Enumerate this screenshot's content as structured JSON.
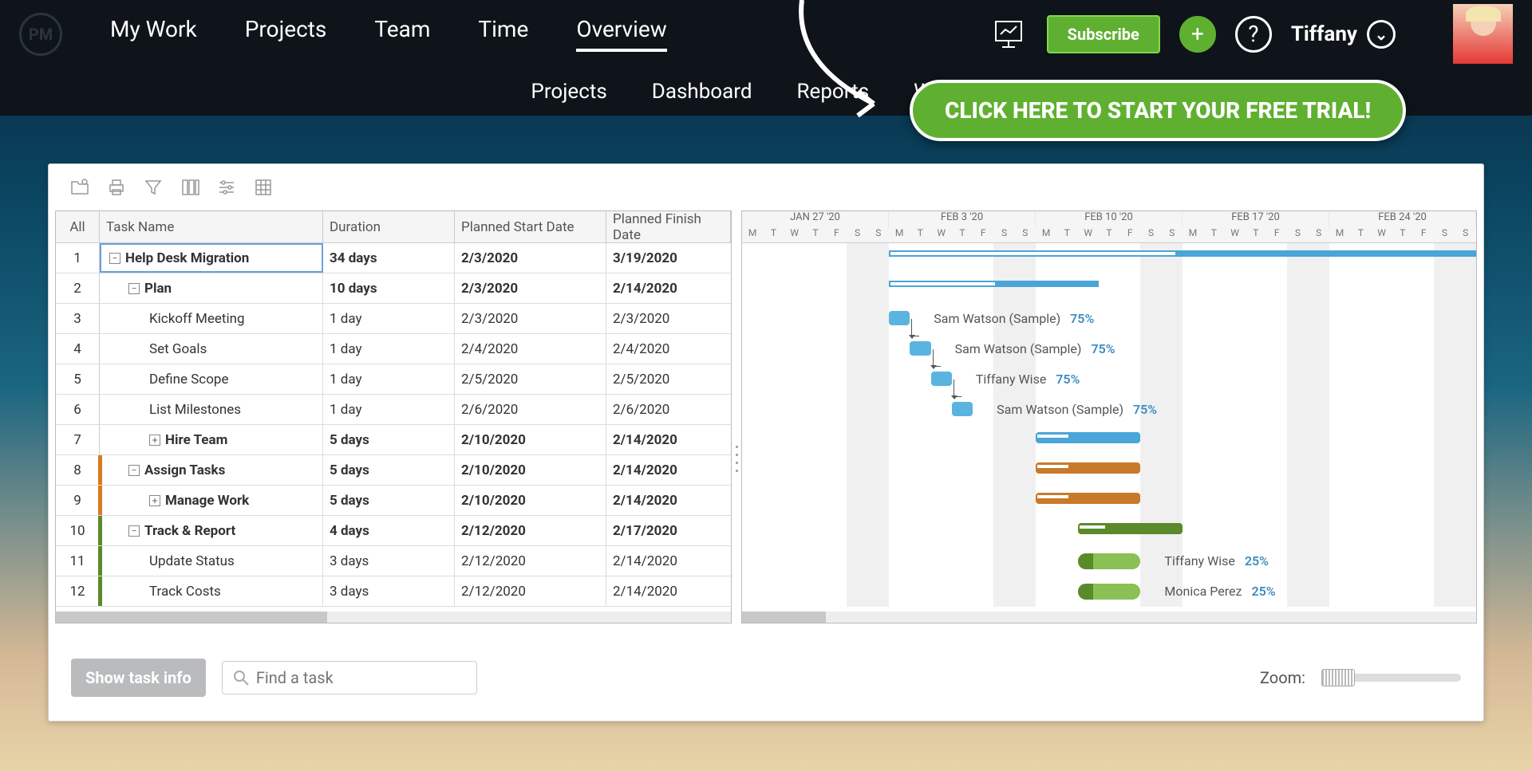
{
  "brand": "PM",
  "nav": {
    "main": [
      "My Work",
      "Projects",
      "Team",
      "Time",
      "Overview"
    ],
    "main_active": 4,
    "sub": [
      "Projects",
      "Dashboard",
      "Reports",
      "Workload"
    ]
  },
  "topright": {
    "subscribe": "Subscribe",
    "plus": "+",
    "help": "?",
    "user": "Tiffany"
  },
  "cta": "CLICK HERE TO START YOUR FREE TRIAL!",
  "columns": {
    "all": "All",
    "task": "Task Name",
    "duration": "Duration",
    "start": "Planned Start Date",
    "finish": "Planned Finish Date"
  },
  "tasks": [
    {
      "n": "1",
      "name": "Help Desk Migration",
      "dur": "34 days",
      "start": "2/3/2020",
      "finish": "3/19/2020",
      "indent": 0,
      "bold": true,
      "exp": "-",
      "sel": true
    },
    {
      "n": "2",
      "name": "Plan",
      "dur": "10 days",
      "start": "2/3/2020",
      "finish": "2/14/2020",
      "indent": 1,
      "bold": true,
      "exp": "-"
    },
    {
      "n": "3",
      "name": "Kickoff Meeting",
      "dur": "1 day",
      "start": "2/3/2020",
      "finish": "2/3/2020",
      "indent": 2
    },
    {
      "n": "4",
      "name": "Set Goals",
      "dur": "1 day",
      "start": "2/4/2020",
      "finish": "2/4/2020",
      "indent": 2
    },
    {
      "n": "5",
      "name": "Define Scope",
      "dur": "1 day",
      "start": "2/5/2020",
      "finish": "2/5/2020",
      "indent": 2
    },
    {
      "n": "6",
      "name": "List Milestones",
      "dur": "1 day",
      "start": "2/6/2020",
      "finish": "2/6/2020",
      "indent": 2
    },
    {
      "n": "7",
      "name": "Hire Team",
      "dur": "5 days",
      "start": "2/10/2020",
      "finish": "2/14/2020",
      "indent": 2,
      "bold": true,
      "exp": "+"
    },
    {
      "n": "8",
      "name": "Assign Tasks",
      "dur": "5 days",
      "start": "2/10/2020",
      "finish": "2/14/2020",
      "indent": 1,
      "bold": true,
      "exp": "-",
      "strip": "orange"
    },
    {
      "n": "9",
      "name": "Manage Work",
      "dur": "5 days",
      "start": "2/10/2020",
      "finish": "2/14/2020",
      "indent": 2,
      "bold": true,
      "exp": "+",
      "strip": "orange"
    },
    {
      "n": "10",
      "name": "Track & Report",
      "dur": "4 days",
      "start": "2/12/2020",
      "finish": "2/17/2020",
      "indent": 1,
      "bold": true,
      "exp": "-",
      "strip": "green"
    },
    {
      "n": "11",
      "name": "Update Status",
      "dur": "3 days",
      "start": "2/12/2020",
      "finish": "2/14/2020",
      "indent": 2,
      "strip": "green"
    },
    {
      "n": "12",
      "name": "Track Costs",
      "dur": "3 days",
      "start": "2/12/2020",
      "finish": "2/14/2020",
      "indent": 2,
      "strip": "green"
    }
  ],
  "weeks": [
    "JAN 27 '20",
    "FEB 3 '20",
    "FEB 10 '20",
    "FEB 17 '20",
    "FEB 24 '20"
  ],
  "days": [
    "M",
    "T",
    "W",
    "T",
    "F",
    "S",
    "S"
  ],
  "gantt_labels": [
    {
      "row": 2,
      "name": "Sam Watson (Sample)",
      "pct": "75%"
    },
    {
      "row": 3,
      "name": "Sam Watson (Sample)",
      "pct": "75%"
    },
    {
      "row": 4,
      "name": "Tiffany Wise",
      "pct": "75%"
    },
    {
      "row": 5,
      "name": "Sam Watson (Sample)",
      "pct": "75%"
    },
    {
      "row": 10,
      "name": "Tiffany Wise",
      "pct": "25%"
    },
    {
      "row": 11,
      "name": "Monica Perez",
      "pct": "25%"
    }
  ],
  "footer": {
    "show_info": "Show task info",
    "find_placeholder": "Find a task",
    "zoom": "Zoom:"
  }
}
